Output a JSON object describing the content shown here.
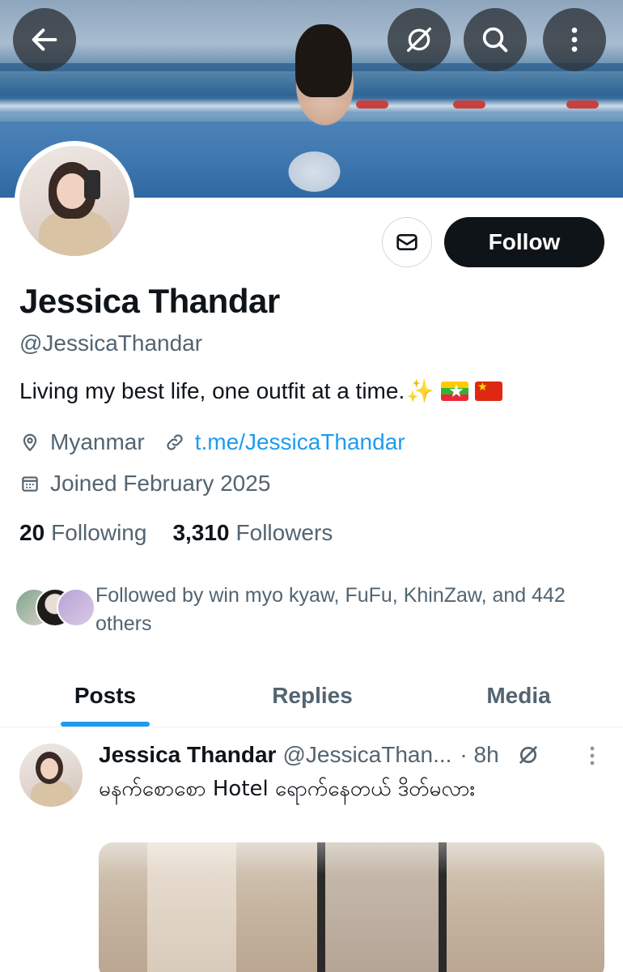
{
  "profile": {
    "name": "Jessica Thandar",
    "handle": "@JessicaThandar",
    "bio": "Living my best life, one outfit at a time.",
    "bio_emoji": "✨",
    "location": "Myanmar",
    "link": "t.me/JessicaThandar",
    "joined": "Joined February 2025",
    "following_count": "20",
    "following_label": "Following",
    "followers_count": "3,310",
    "followers_label": "Followers",
    "followed_by": "Followed by win myo kyaw, FuFu, KhinZaw, and 442 others"
  },
  "actions": {
    "follow_label": "Follow"
  },
  "tabs": [
    {
      "label": "Posts",
      "active": true
    },
    {
      "label": "Replies",
      "active": false
    },
    {
      "label": "Media",
      "active": false
    }
  ],
  "post": {
    "author": "Jessica Thandar",
    "handle": "@JessicaThan...",
    "time": "· 8h",
    "text": "မနက်စောစော Hotel ရောက်နေတယ် ဒိတ်မလား"
  },
  "colors": {
    "accent": "#1d9bf0",
    "text": "#0f1419",
    "secondary": "#536471",
    "button_dark": "#0f1419"
  },
  "icons": {
    "back": "arrow-left-icon",
    "grok": "grok-icon",
    "search": "search-icon",
    "more": "more-vertical-icon",
    "message": "mail-icon",
    "location": "location-pin-icon",
    "link": "link-icon",
    "calendar": "calendar-icon"
  }
}
